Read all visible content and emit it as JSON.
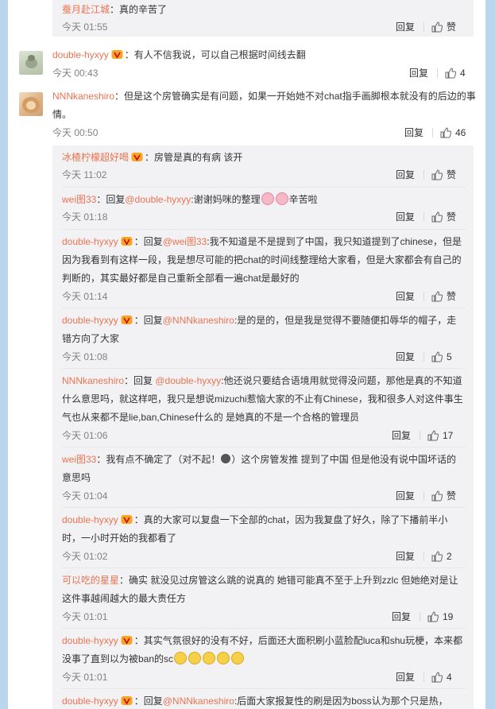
{
  "colors": {
    "accent": "#eb7350",
    "page_bg": "#b9d6ec",
    "reply_bg": "#f2f2f5"
  },
  "labels": {
    "reply": "回复",
    "like_zh": "赞"
  },
  "r0": {
    "user": "蚕月赴江城",
    "text": "：真的辛苦了",
    "time": "今天 01:55"
  },
  "c1": {
    "user": "double-hyxyy",
    "text": "：有人不信我说，可以自己根据时间线去翻",
    "time": "今天 00:43",
    "likes": "4"
  },
  "c2": {
    "user": "NNNkaneshiro",
    "text": "：但是这个房管确实是有问题，如果一开始她不对chat指手画脚根本就没有的后边的事情。",
    "time": "今天 00:50",
    "likes": "46"
  },
  "r1": {
    "user": "冰楂柠檬超好喝",
    "text": "：房管是真的有病 该开",
    "time": "今天 11:02"
  },
  "r2": {
    "user": "wei图33",
    "pre": "：回复",
    "mention": "@double-hyxyy",
    "text": ":谢谢妈咪的整理",
    "post": "辛苦啦",
    "time": "今天 01:18"
  },
  "r3": {
    "user": "double-hyxyy",
    "pre": "：回复",
    "mention": "@wei图33",
    "text": ":我不知道是不是提到了中国，我只知道提到了chinese，但是因为我看到有这样一段，我是想尽可能的把chat的时间线整理给大家看，但是大家都会有自己的判断的，其实最好都是自己重新全部看一遍chat是最好的",
    "time": "今天 01:14"
  },
  "r4": {
    "user": "double-hyxyy",
    "pre": "：回复",
    "mention": "@NNNkaneshiro",
    "text": ":是的是的，但是我是觉得不要随便扣辱华的帽子，走错方向了大家",
    "time": "今天 01:08",
    "likes": "5"
  },
  "r5": {
    "user": "NNNkaneshiro",
    "pre": "：回复 ",
    "mention": "@double-hyxyy",
    "text": ":他还说只要结合语境用就觉得没问题，那他是真的不知道什么意思吗，就这样吧，我只是想说mizuchi惹恼大家的不止有Chinese，我和很多人对这件事生气也从来都不是lie,ban,Chinese什么的 是她真的不是一个合格的管理员",
    "time": "今天 01:06",
    "likes": "17"
  },
  "r6": {
    "user": "wei图33",
    "text": "：我有点不确定了（对不起！",
    "text2": "）这个房管发推 提到了中国 但是他没有说中国坏话的意思吗",
    "time": "今天 01:04"
  },
  "r7": {
    "user": "double-hyxyy",
    "text": "：真的大家可以复盘一下全部的chat，因为我复盘了好久，除了下播前半小时，一小时开始的我都看了",
    "time": "今天 01:02",
    "likes": "2"
  },
  "r8": {
    "user": "可以吃的星星",
    "text": "：确实 就没见过房管这么跳的说真的 她错可能真不至于上升到zzlc 但她绝对是让这件事越闹越大的最大责任方",
    "time": "今天 01:01",
    "likes": "19"
  },
  "r9": {
    "user": "double-hyxyy",
    "text": "：其实气氛很好的没有不好，后面还大面积刷小蓝脸配luca和shu玩梗，本来都没事了直到以为被ban的sc",
    "time": "今天 01:01",
    "likes": "4"
  },
  "r10": {
    "user": "double-hyxyy",
    "pre": "：回复",
    "mention": "@NNNkaneshiro",
    "text": ":后面大家报复性的刷是因为boss认为那个只是热，"
  }
}
